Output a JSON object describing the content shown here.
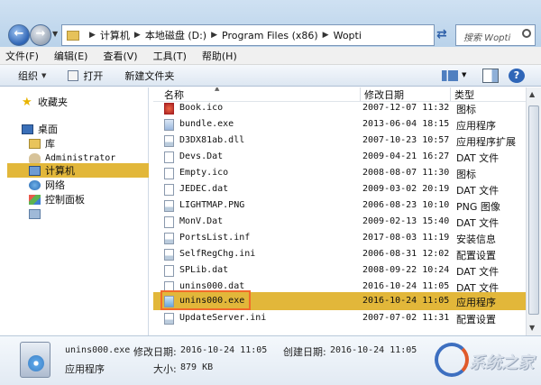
{
  "address": {
    "crumbs": [
      "计算机",
      "本地磁盘 (D:)",
      "Program Files (x86)",
      "Wopti"
    ],
    "search_placeholder": "搜索 Wopti"
  },
  "menu": [
    "文件(F)",
    "编辑(E)",
    "查看(V)",
    "工具(T)",
    "帮助(H)"
  ],
  "toolbar": {
    "organize": "组织",
    "open": "打开",
    "new_folder": "新建文件夹"
  },
  "nav": [
    {
      "label": "收藏夹",
      "icon": "star-icon"
    },
    {
      "label": "桌面",
      "icon": "desktop-icon"
    },
    {
      "label": "库",
      "icon": "library-icon"
    },
    {
      "label": "Administrator",
      "icon": "user-folder-icon"
    },
    {
      "label": "计算机",
      "icon": "computer-icon",
      "selected": true
    },
    {
      "label": "网络",
      "icon": "network-icon"
    },
    {
      "label": "控制面板",
      "icon": "control-panel-icon"
    },
    {
      "label": "",
      "icon": "recycle-bin-icon"
    }
  ],
  "columns": {
    "name": "名称",
    "date": "修改日期",
    "type": "类型"
  },
  "files": [
    {
      "name": "Book.ico",
      "date": "2007-12-07 11:32",
      "type": "图标",
      "icon": "icon-file-icon"
    },
    {
      "name": "bundle.exe",
      "date": "2013-06-04 18:15",
      "type": "应用程序",
      "icon": "exe-file-icon"
    },
    {
      "name": "D3DX81ab.dll",
      "date": "2007-10-23 10:57",
      "type": "应用程序扩展",
      "icon": "dll-file-icon"
    },
    {
      "name": "Devs.Dat",
      "date": "2009-04-21 16:27",
      "type": "DAT 文件",
      "icon": "dat-file-icon"
    },
    {
      "name": "Empty.ico",
      "date": "2008-08-07 11:30",
      "type": "图标",
      "icon": "icon-file-icon"
    },
    {
      "name": "JEDEC.dat",
      "date": "2009-03-02 20:19",
      "type": "DAT 文件",
      "icon": "dat-file-icon"
    },
    {
      "name": "LIGHTMAP.PNG",
      "date": "2006-08-23 10:10",
      "type": "PNG 图像",
      "icon": "png-file-icon"
    },
    {
      "name": "MonV.Dat",
      "date": "2009-02-13 15:40",
      "type": "DAT 文件",
      "icon": "dat-file-icon"
    },
    {
      "name": "PortsList.inf",
      "date": "2017-08-03 11:19",
      "type": "安装信息",
      "icon": "inf-file-icon"
    },
    {
      "name": "SelfRegChg.ini",
      "date": "2006-08-31 12:02",
      "type": "配置设置",
      "icon": "ini-file-icon"
    },
    {
      "name": "SPLib.dat",
      "date": "2008-09-22 10:24",
      "type": "DAT 文件",
      "icon": "dat-file-icon"
    },
    {
      "name": "unins000.dat",
      "date": "2016-10-24 11:05",
      "type": "DAT 文件",
      "icon": "dat-file-icon"
    },
    {
      "name": "unins000.exe",
      "date": "2016-10-24 11:05",
      "type": "应用程序",
      "icon": "setup-exe-icon",
      "selected": true
    },
    {
      "name": "UpdateServer.ini",
      "date": "2007-07-02 11:31",
      "type": "配置设置",
      "icon": "ini-file-icon"
    }
  ],
  "details": {
    "filename": "unins000.exe",
    "modified_label": "修改日期:",
    "modified_value": "2016-10-24 11:05",
    "created_label": "创建日期:",
    "created_value": "2016-10-24 11:05",
    "type_value": "应用程序",
    "size_label": "大小:",
    "size_value": "879 KB"
  },
  "colors": {
    "selection": "#e2b73a",
    "highlight_box": "#f26b2a",
    "accent": "#2f66b8"
  }
}
